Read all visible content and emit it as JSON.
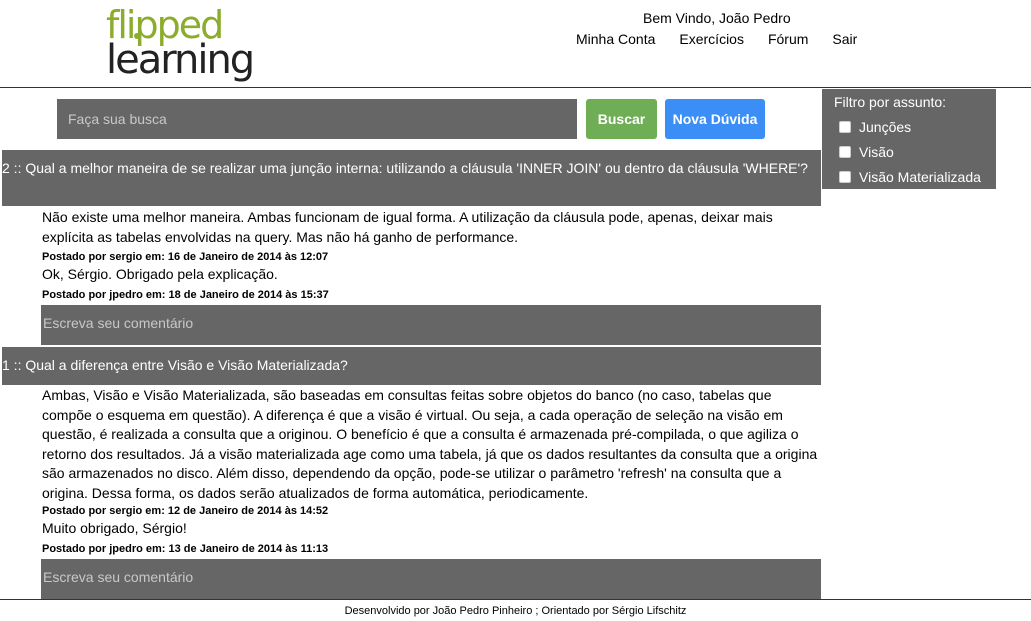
{
  "logo": {
    "line1": "flipped",
    "line2": "learning"
  },
  "header": {
    "welcome": "Bem Vindo, João Pedro",
    "nav": [
      "Minha Conta",
      "Exercícios",
      "Fórum",
      "Sair"
    ]
  },
  "search": {
    "placeholder": "Faça sua busca",
    "search_button": "Buscar",
    "new_question_button": "Nova Dúvida"
  },
  "filter": {
    "title": "Filtro por assunto:",
    "options": [
      "Junções",
      "Visão",
      "Visão Materializada"
    ]
  },
  "questions": [
    {
      "title": "2 :: Qual a melhor maneira de se realizar uma junção interna: utilizando a cláusula 'INNER JOIN' ou dentro da cláusula 'WHERE'?",
      "posts": [
        {
          "text": "Não existe uma melhor maneira. Ambas funcionam de igual forma. A utilização da cláusula pode, apenas, deixar mais explícita as tabelas envolvidas na query. Mas não há ganho de performance.",
          "meta": "Postado por sergio em: 16 de Janeiro de 2014 às 12:07"
        },
        {
          "text": "Ok, Sérgio. Obrigado pela explicação.",
          "meta": "Postado por jpedro em: 18 de Janeiro de 2014 às 15:37"
        }
      ],
      "comment_placeholder": "Escreva seu comentário"
    },
    {
      "title": "1 :: Qual a diferença entre Visão e Visão Materializada?",
      "posts": [
        {
          "text": "Ambas, Visão e Visão Materializada, são baseadas em consultas feitas sobre objetos do banco (no caso, tabelas que compõe o esquema em questão). A diferença é que a visão é virtual. Ou seja, a cada operação de seleção na visão em questão, é realizada a consulta que a originou. O benefício é que a consulta é armazenada pré-compilada, o que agiliza o retorno dos resultados. Já a visão materializada age como uma tabela, já que os dados resultantes da consulta que a origina são armazenados no disco. Além disso, dependendo da opção, pode-se utilizar o parâmetro 'refresh' na consulta que a origina. Dessa forma, os dados serão atualizados de forma automática, periodicamente.",
          "meta": "Postado por sergio em: 12 de Janeiro de 2014 às 14:52"
        },
        {
          "text": "Muito obrigado, Sérgio!",
          "meta": "Postado por jpedro em: 13 de Janeiro de 2014 às 11:13"
        }
      ],
      "comment_placeholder": "Escreva seu comentário"
    }
  ],
  "footer": "Desenvolvido por João Pedro Pinheiro ; Orientado por Sérgio Lifschitz",
  "colors": {
    "panel_gray": "#666666",
    "search_green": "#6fae55",
    "new_blue": "#3b8ef5",
    "logo_green": "#8cac2e"
  }
}
